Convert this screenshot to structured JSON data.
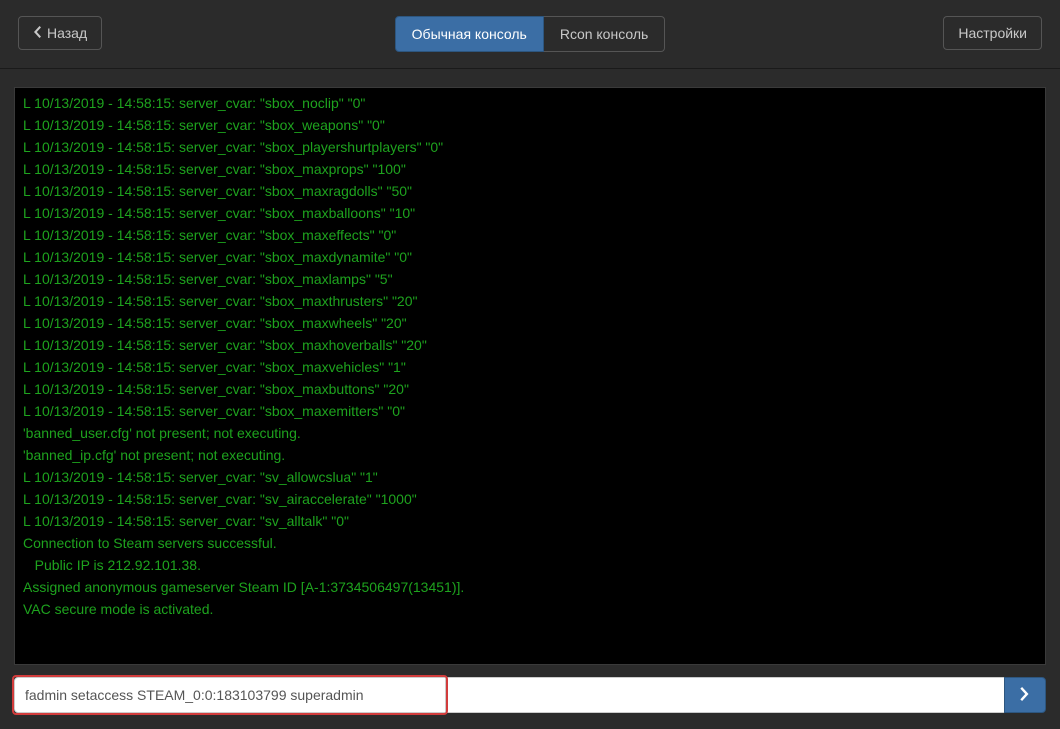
{
  "topbar": {
    "back_label": "Назад",
    "settings_label": "Настройки"
  },
  "tabs": {
    "normal": "Обычная консоль",
    "rcon": "Rcon консоль"
  },
  "console": {
    "lines": [
      "L 10/13/2019 - 14:58:15: server_cvar: \"sbox_noclip\" \"0\"",
      "L 10/13/2019 - 14:58:15: server_cvar: \"sbox_weapons\" \"0\"",
      "L 10/13/2019 - 14:58:15: server_cvar: \"sbox_playershurtplayers\" \"0\"",
      "L 10/13/2019 - 14:58:15: server_cvar: \"sbox_maxprops\" \"100\"",
      "L 10/13/2019 - 14:58:15: server_cvar: \"sbox_maxragdolls\" \"50\"",
      "L 10/13/2019 - 14:58:15: server_cvar: \"sbox_maxballoons\" \"10\"",
      "L 10/13/2019 - 14:58:15: server_cvar: \"sbox_maxeffects\" \"0\"",
      "L 10/13/2019 - 14:58:15: server_cvar: \"sbox_maxdynamite\" \"0\"",
      "L 10/13/2019 - 14:58:15: server_cvar: \"sbox_maxlamps\" \"5\"",
      "L 10/13/2019 - 14:58:15: server_cvar: \"sbox_maxthrusters\" \"20\"",
      "L 10/13/2019 - 14:58:15: server_cvar: \"sbox_maxwheels\" \"20\"",
      "L 10/13/2019 - 14:58:15: server_cvar: \"sbox_maxhoverballs\" \"20\"",
      "L 10/13/2019 - 14:58:15: server_cvar: \"sbox_maxvehicles\" \"1\"",
      "L 10/13/2019 - 14:58:15: server_cvar: \"sbox_maxbuttons\" \"20\"",
      "L 10/13/2019 - 14:58:15: server_cvar: \"sbox_maxemitters\" \"0\"",
      "'banned_user.cfg' not present; not executing.",
      "'banned_ip.cfg' not present; not executing.",
      "L 10/13/2019 - 14:58:15: server_cvar: \"sv_allowcslua\" \"1\"",
      "L 10/13/2019 - 14:58:15: server_cvar: \"sv_airaccelerate\" \"1000\"",
      "L 10/13/2019 - 14:58:15: server_cvar: \"sv_alltalk\" \"0\"",
      "Connection to Steam servers successful.",
      "   Public IP is 212.92.101.38.",
      "Assigned anonymous gameserver Steam ID [A-1:3734506497(13451)].",
      "VAC secure mode is activated."
    ]
  },
  "command": {
    "value": "fadmin setaccess STEAM_0:0:183103799 superadmin"
  }
}
